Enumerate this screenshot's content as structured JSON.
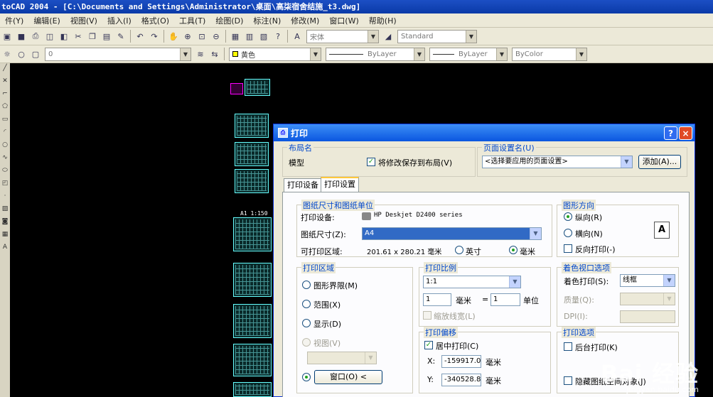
{
  "window": {
    "title": "toCAD 2004 - [C:\\Documents and Settings\\Administrator\\桌面\\高柒宿舍结施_t3.dwg]"
  },
  "menu": [
    "件(Y)",
    "编辑(E)",
    "视图(V)",
    "插入(I)",
    "格式(O)",
    "工具(T)",
    "绘图(D)",
    "标注(N)",
    "修改(M)",
    "窗口(W)",
    "帮助(H)"
  ],
  "toolbar": {
    "font_combo": "宋体",
    "style_combo": "Standard",
    "layer_combo": "0",
    "color_combo": "黄色",
    "linetype_combo": "ByLayer",
    "lineweight_combo": "ByLayer",
    "plotstyle_combo": "ByColor"
  },
  "drawing": {
    "sheet_label": "A1 1:150"
  },
  "dialog": {
    "title": "打印",
    "help_label": "?",
    "close_label": "×",
    "layout_group": "布局名",
    "layout_name": "模型",
    "save_to_layout": "将修改保存到布局(V)",
    "page_setup_group": "页面设置名(U)",
    "page_setup_value": "<选择要应用的页面设置>",
    "add_button": "添加(A)...",
    "tabs": [
      "打印设备",
      "打印设置"
    ],
    "paper": {
      "group": "图纸尺寸和图纸单位",
      "device_label": "打印设备:",
      "device_value": "HP Deskjet D2400 series",
      "size_label": "图纸尺寸(Z):",
      "size_value": "A4",
      "area_label": "可打印区域:",
      "area_value": "201.61 x 280.21 毫米",
      "inch_label": "英寸",
      "mm_label": "毫米"
    },
    "orientation": {
      "group": "图形方向",
      "portrait": "纵向(R)",
      "landscape": "横向(N)",
      "reverse": "反向打印(-)",
      "icon_letter": "A"
    },
    "plot_area": {
      "group": "打印区域",
      "limits": "图形界限(M)",
      "extents": "范围(X)",
      "display": "显示(D)",
      "view": "视图(V)",
      "window": "窗口(O) <"
    },
    "scale": {
      "group": "打印比例",
      "value": "1:1",
      "mm_value": "1",
      "mm_label": "毫米",
      "equals": "=",
      "unit_value": "1",
      "unit_label": "单位",
      "scale_lw": "缩放线宽(L)"
    },
    "offset": {
      "group": "打印偏移",
      "center": "居中打印(C)",
      "x_label": "X:",
      "x_value": "-159917.0",
      "x_unit": "毫米",
      "y_label": "Y:",
      "y_value": "-340528.8",
      "y_unit": "毫米"
    },
    "shaded": {
      "group": "着色视口选项",
      "shade_label": "着色打印(S):",
      "shade_value": "线框",
      "quality_label": "质量(Q):",
      "dpi_label": "DPI(I):"
    },
    "options": {
      "group": "打印选项",
      "item1": "后台打印(K)",
      "item2": "隐藏图纸空间对象(J)"
    }
  },
  "watermark": {
    "text": "Bai 经验",
    "url": "jingyan.baidu.com"
  }
}
